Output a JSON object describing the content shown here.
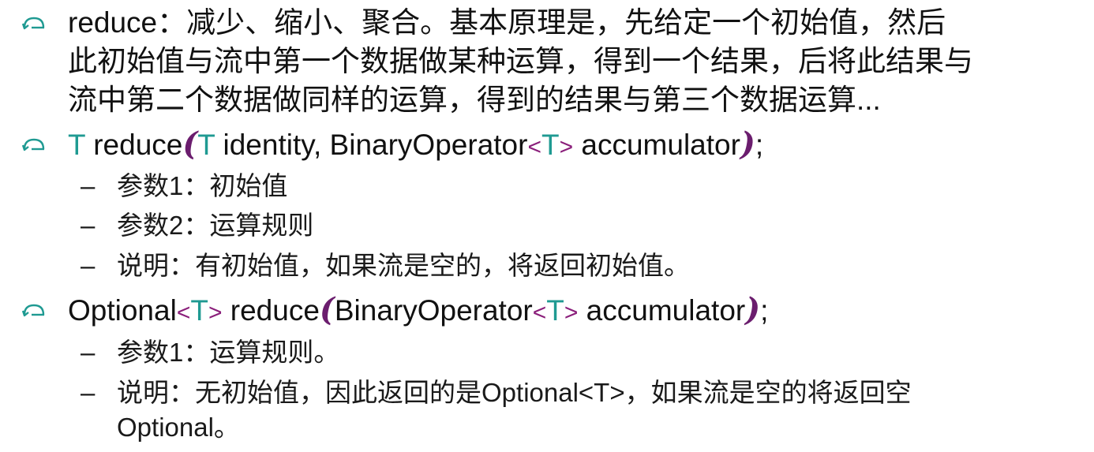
{
  "bullet1": {
    "lines": [
      "reduce：减少、缩小、聚合。基本原理是，先给定一个初始值，然后",
      "此初始值与流中第一个数据做某种运算，得到一个结果，后将此结果与",
      "流中第二个数据做同样的运算，得到的结果与第三个数据运算..."
    ]
  },
  "bullet2": {
    "sig": {
      "ret": "T",
      "name": " reduce",
      "lparen": "(",
      "param_type": "T",
      "param1": " identity, BinaryOperator",
      "lt": "<",
      "generic": "T",
      "gt": ">",
      "param2": " accumulator",
      "rparen": ")",
      "semi": ";"
    },
    "subs": [
      "参数1：初始值",
      "参数2：运算规则",
      "说明：有初始值，如果流是空的，将返回初始值。"
    ]
  },
  "bullet3": {
    "sig": {
      "ret": "Optional",
      "lt1": "<",
      "gen1": "T",
      "gt1": ">",
      "name": " reduce",
      "lparen": "(",
      "param_type": "BinaryOperator",
      "lt2": "<",
      "gen2": "T",
      "gt2": ">",
      "param": " accumulator",
      "rparen": ")",
      "semi": ";"
    },
    "subs": [
      "参数1：运算规则。",
      [
        "说明：无初始值，因此返回的是Optional<T>，如果流是空的将返回空",
        "Optional。"
      ]
    ]
  },
  "dash": "–",
  "colors": {
    "bullet_icon": "#1f9a92",
    "generic_type": "#1f9a92",
    "angle_brackets": "#8a1e7a",
    "parens": "#6b1d6e"
  },
  "icons": {
    "bullet": "curved-arrow-bullet-icon"
  }
}
